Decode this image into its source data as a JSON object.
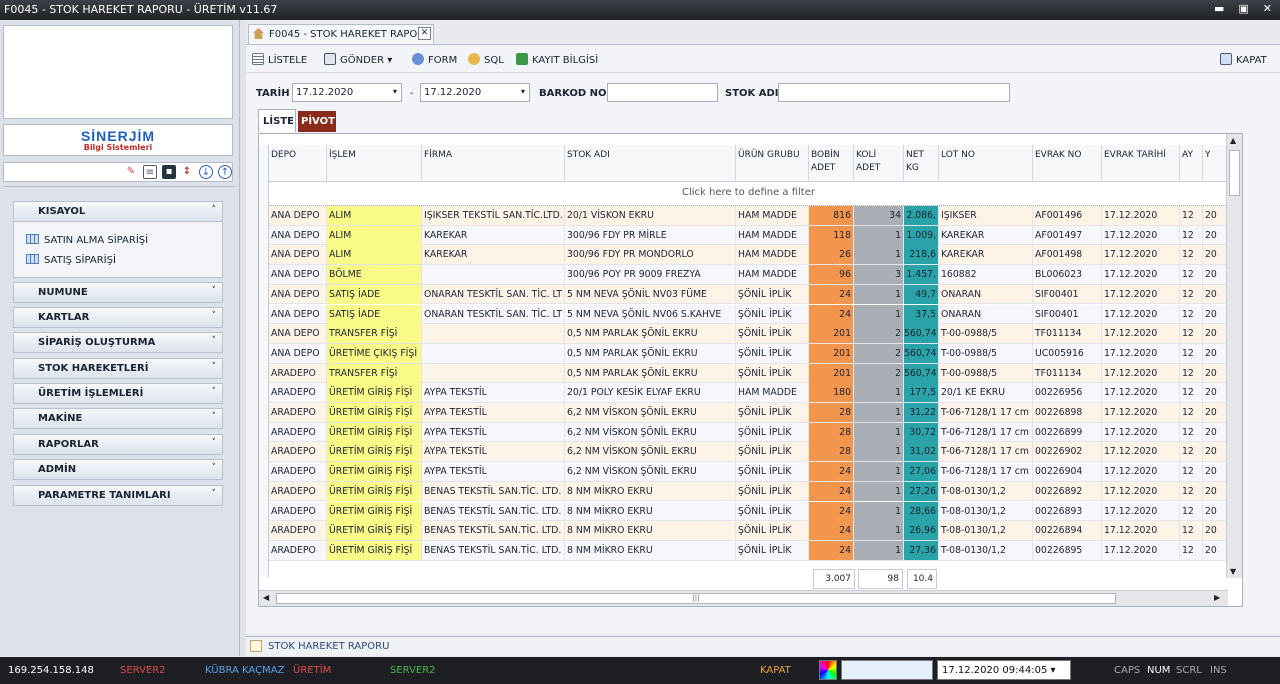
{
  "window": {
    "title": "F0045 - STOK HAREKET RAPORU - ÜRETİM v11.67",
    "min": "▬",
    "max": "▣",
    "close": "✕"
  },
  "left": {
    "brand": {
      "name": "SİNERJİM",
      "sub": "Bilgi Sistemleri"
    },
    "groups": [
      {
        "label": "KISAYOL",
        "chev": "˄"
      },
      {
        "label": "NUMUNE",
        "chev": "˅"
      },
      {
        "label": "KARTLAR",
        "chev": "˅"
      },
      {
        "label": "SİPARİŞ OLUŞTURMA",
        "chev": "˅"
      },
      {
        "label": "STOK HAREKETLERİ",
        "chev": "˅"
      },
      {
        "label": "ÜRETİM İŞLEMLERİ",
        "chev": "˅"
      },
      {
        "label": "MAKİNE",
        "chev": "˅"
      },
      {
        "label": "RAPORLAR",
        "chev": "˅"
      },
      {
        "label": "ADMİN",
        "chev": "˅"
      },
      {
        "label": "PARAMETRE TANIMLARI",
        "chev": "˅"
      }
    ],
    "shortcuts": [
      "SATIN ALMA SİPARİŞİ",
      "SATIŞ SİPARİŞİ"
    ]
  },
  "tab": {
    "title": "F0045 - STOK HAREKET RAPORU",
    "close": "✕"
  },
  "toolbar": {
    "listele": "LİSTELE",
    "gonder": "GÖNDER",
    "form": "FORM",
    "sql": "SQL",
    "kayit": "KAYIT BİLGİSİ",
    "kapat": "KAPAT",
    "dd": "▾"
  },
  "filters": {
    "tarih_label": "TARİH",
    "tarih1": "17.12.2020",
    "dash": "-",
    "tarih2": "17.12.2020",
    "barkod_label": "BARKOD NO",
    "stok_label": "STOK ADI",
    "dd": "▾"
  },
  "subtabs": {
    "liste": "LİSTE",
    "pivot": "PİVOT"
  },
  "grid": {
    "columns": [
      "DEPO",
      "İŞLEM",
      "FİRMA",
      "STOK ADI",
      "ÜRÜN GRUBU",
      "BOBİN ADET",
      "KOLİ ADET",
      "NET KG",
      "LOT NO",
      "EVRAK NO",
      "EVRAK TARİHİ",
      "AY",
      "Y"
    ],
    "filter_text": "Click here to define a filter",
    "rows": [
      [
        "ANA DEPO",
        "ALIM",
        "IŞIKSER TEKSTİL SAN.TİC.LTD.",
        "20/1 VİSKON EKRU",
        "HAM MADDE",
        "816",
        "34",
        "2.086,",
        "IŞIKSER",
        "AF001496",
        "17.12.2020",
        "12",
        "20"
      ],
      [
        "ANA DEPO",
        "ALIM",
        "KAREKAR",
        "300/96 FDY PR MİRLE",
        "HAM MADDE",
        "118",
        "1",
        "1.009,",
        "KAREKAR",
        "AF001497",
        "17.12.2020",
        "12",
        "20"
      ],
      [
        "ANA DEPO",
        "ALIM",
        "KAREKAR",
        "300/96 FDY PR MONDORLO",
        "HAM MADDE",
        "26",
        "1",
        "218,6",
        "KAREKAR",
        "AF001498",
        "17.12.2020",
        "12",
        "20"
      ],
      [
        "ANA DEPO",
        "BÖLME",
        "",
        "300/96 POY PR 9009 FREZYA",
        "HAM MADDE",
        "96",
        "3",
        "1.457,",
        "160882",
        "BL006023",
        "17.12.2020",
        "12",
        "20"
      ],
      [
        "ANA DEPO",
        "SATIŞ İADE",
        "ONARAN TESKTİL SAN. TİC. LT",
        "5 NM NEVA ŞÖNİL NV03 FÜME",
        "ŞÖNİL İPLİK",
        "24",
        "1",
        "49,7",
        "ONARAN",
        "SIF00401",
        "17.12.2020",
        "12",
        "20"
      ],
      [
        "ANA DEPO",
        "SATIŞ İADE",
        "ONARAN TESKTİL SAN. TİC. LT",
        "5 NM NEVA ŞÖNİL NV06 S.KAHVE",
        "ŞÖNİL İPLİK",
        "24",
        "1",
        "37,5",
        "ONARAN",
        "SIF00401",
        "17.12.2020",
        "12",
        "20"
      ],
      [
        "ANA DEPO",
        "TRANSFER FİŞİ",
        "",
        "0,5 NM PARLAK ŞÖNİL EKRU",
        "ŞÖNİL İPLİK",
        "201",
        "2",
        "560,74",
        "T-00-0988/5",
        "TF011134",
        "17.12.2020",
        "12",
        "20"
      ],
      [
        "ANA DEPO",
        "ÜRETİME ÇIKIŞ FİŞİ",
        "",
        "0,5 NM PARLAK ŞÖNİL EKRU",
        "ŞÖNİL İPLİK",
        "201",
        "2",
        "560,74",
        "T-00-0988/5",
        "UC005916",
        "17.12.2020",
        "12",
        "20"
      ],
      [
        "ARADEPO",
        "TRANSFER FİŞİ",
        "",
        "0,5 NM PARLAK ŞÖNİL EKRU",
        "ŞÖNİL İPLİK",
        "201",
        "2",
        "560,74",
        "T-00-0988/5",
        "TF011134",
        "17.12.2020",
        "12",
        "20"
      ],
      [
        "ARADEPO",
        "ÜRETİM GİRİŞ FİŞİ",
        "AYPA TEKSTİL",
        "20/1 POLY KESİK ELYAF EKRU",
        "HAM MADDE",
        "180",
        "1",
        "177,5",
        "20/1 KE EKRU",
        "00226956",
        "17.12.2020",
        "12",
        "20"
      ],
      [
        "ARADEPO",
        "ÜRETİM GİRİŞ FİŞİ",
        "AYPA TEKSTİL",
        "6,2 NM VİSKON ŞÖNİL EKRU",
        "ŞÖNİL İPLİK",
        "28",
        "1",
        "31,22",
        "T-06-7128/1 17 cm",
        "00226898",
        "17.12.2020",
        "12",
        "20"
      ],
      [
        "ARADEPO",
        "ÜRETİM GİRİŞ FİŞİ",
        "AYPA TEKSTİL",
        "6,2 NM VİSKON ŞÖNİL EKRU",
        "ŞÖNİL İPLİK",
        "28",
        "1",
        "30,72",
        "T-06-7128/1 17 cm",
        "00226899",
        "17.12.2020",
        "12",
        "20"
      ],
      [
        "ARADEPO",
        "ÜRETİM GİRİŞ FİŞİ",
        "AYPA TEKSTİL",
        "6,2 NM VİSKON ŞÖNİL EKRU",
        "ŞÖNİL İPLİK",
        "28",
        "1",
        "31,02",
        "T-06-7128/1 17 cm",
        "00226902",
        "17.12.2020",
        "12",
        "20"
      ],
      [
        "ARADEPO",
        "ÜRETİM GİRİŞ FİŞİ",
        "AYPA TEKSTİL",
        "6,2 NM VİSKON ŞÖNİL EKRU",
        "ŞÖNİL İPLİK",
        "24",
        "1",
        "27,06",
        "T-06-7128/1 17 cm",
        "00226904",
        "17.12.2020",
        "12",
        "20"
      ],
      [
        "ARADEPO",
        "ÜRETİM GİRİŞ FİŞİ",
        "BENAS TEKSTİL SAN.TİC. LTD.",
        "8 NM MİKRO EKRU",
        "ŞÖNİL İPLİK",
        "24",
        "1",
        "27,26",
        "T-08-0130/1,2",
        "00226892",
        "17.12.2020",
        "12",
        "20"
      ],
      [
        "ARADEPO",
        "ÜRETİM GİRİŞ FİŞİ",
        "BENAS TEKSTİL SAN.TİC. LTD.",
        "8 NM MİKRO EKRU",
        "ŞÖNİL İPLİK",
        "24",
        "1",
        "28,66",
        "T-08-0130/1,2",
        "00226893",
        "17.12.2020",
        "12",
        "20"
      ],
      [
        "ARADEPO",
        "ÜRETİM GİRİŞ FİŞİ",
        "BENAS TEKSTİL SAN.TİC. LTD.",
        "8 NM MİKRO EKRU",
        "ŞÖNİL İPLİK",
        "24",
        "1",
        "26,96",
        "T-08-0130/1,2",
        "00226894",
        "17.12.2020",
        "12",
        "20"
      ],
      [
        "ARADEPO",
        "ÜRETİM GİRİŞ FİŞİ",
        "BENAS TEKSTİL SAN.TİC. LTD.",
        "8 NM MİKRO EKRU",
        "ŞÖNİL İPLİK",
        "24",
        "1",
        "27,36",
        "T-08-0130/1,2",
        "00226895",
        "17.12.2020",
        "12",
        "20"
      ]
    ],
    "totals": {
      "bobin": "3.007",
      "koli": "98",
      "netkg": "10.4"
    },
    "hscroll_grip": "|||"
  },
  "bottom_tab": "STOK HAREKET RAPORU",
  "status": {
    "ip": "169.254.158.148",
    "server": "SERVER2",
    "user": "KÜBRA KAÇMAZ",
    "module": "ÜRETİM",
    "server2": "SERVER2",
    "kapat": "KAPAT",
    "datetime": "17.12.2020 09:44:05",
    "caps": "CAPS",
    "num": "NUM",
    "scrl": "SCRL",
    "ins": "INS",
    "dd": "▾"
  }
}
